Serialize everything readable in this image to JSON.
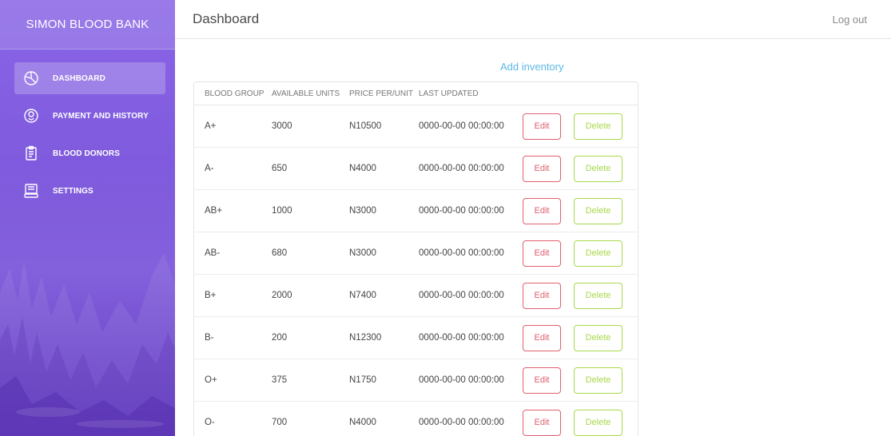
{
  "domain": "Computer-Use",
  "sidebar": {
    "brand": "SIMON BLOOD BANK",
    "items": [
      {
        "label": "DASHBOARD",
        "icon": "pie-chart-icon",
        "active": true
      },
      {
        "label": "PAYMENT AND HISTORY",
        "icon": "person-circle-icon",
        "active": false
      },
      {
        "label": "BLOOD DONORS",
        "icon": "clipboard-icon",
        "active": false
      },
      {
        "label": "SETTINGS",
        "icon": "monitor-icon",
        "active": false
      }
    ]
  },
  "header": {
    "title": "Dashboard",
    "logout": "Log out"
  },
  "main": {
    "add_inventory": "Add inventory",
    "table": {
      "columns": [
        "BLOOD GROUP",
        "AVAILABLE UNITS",
        "PRICE PER/UNIT",
        "LAST UPDATED"
      ],
      "rows": [
        {
          "group": "A+",
          "units": "3000",
          "price": "N10500",
          "updated": "0000-00-00 00:00:00"
        },
        {
          "group": "A-",
          "units": "650",
          "price": "N4000",
          "updated": "0000-00-00 00:00:00"
        },
        {
          "group": "AB+",
          "units": "1000",
          "price": "N3000",
          "updated": "0000-00-00 00:00:00"
        },
        {
          "group": "AB-",
          "units": "680",
          "price": "N3000",
          "updated": "0000-00-00 00:00:00"
        },
        {
          "group": "B+",
          "units": "2000",
          "price": "N7400",
          "updated": "0000-00-00 00:00:00"
        },
        {
          "group": "B-",
          "units": "200",
          "price": "N12300",
          "updated": "0000-00-00 00:00:00"
        },
        {
          "group": "O+",
          "units": "375",
          "price": "N1750",
          "updated": "0000-00-00 00:00:00"
        },
        {
          "group": "O-",
          "units": "700",
          "price": "N4000",
          "updated": "0000-00-00 00:00:00"
        }
      ],
      "edit_label": "Edit",
      "delete_label": "Delete"
    }
  },
  "colors": {
    "sidebar_top": "#8a65e6",
    "sidebar_bottom": "#6f48d2",
    "link": "#5bb8e6",
    "edit": "#e0606f",
    "delete": "#a8d94a"
  }
}
